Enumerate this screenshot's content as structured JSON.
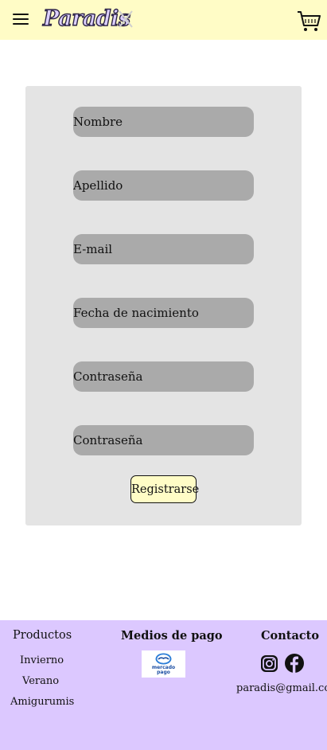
{
  "header": {
    "logo_text": "Paradis",
    "menu_icon": "hamburger-menu-icon",
    "cart_icon": "shopping-cart-icon",
    "background_color": "#fffcc6"
  },
  "form": {
    "fields": [
      {
        "placeholder": "Nombre",
        "type": "text"
      },
      {
        "placeholder": "Apellido",
        "type": "text"
      },
      {
        "placeholder": "E-mail",
        "type": "email"
      },
      {
        "placeholder": "Fecha de nacimiento",
        "type": "text"
      },
      {
        "placeholder": "Contraseña",
        "type": "password"
      },
      {
        "placeholder": "Contraseña",
        "type": "password"
      }
    ],
    "submit_label": "Registrarse",
    "card_color": "#e4e4e4",
    "field_color": "#aaaaaa"
  },
  "footer": {
    "background_color": "#dcc8ff",
    "products": {
      "title": "Productos",
      "links": [
        "Invierno",
        "Verano",
        "Amigurumis"
      ]
    },
    "payment": {
      "title": "Medios de pago",
      "logo_line1": "mercado",
      "logo_line2": "pago"
    },
    "contact": {
      "title": "Contacto",
      "email": "paradis@gmail.com",
      "icons": [
        "instagram-icon",
        "facebook-icon"
      ]
    }
  }
}
